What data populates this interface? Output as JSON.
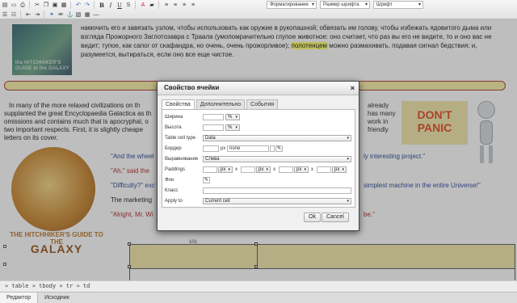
{
  "toolbar": {
    "format_select": "Форматирование",
    "font_size_select": "Размер шрифта",
    "font_select": "Шрифт"
  },
  "editor": {
    "book_cover_text": "the HITCHHIKER'S GUIDE to the GALAXY",
    "russian_text_before": "намочить его и завязать узлом, чтобы использовать как оружие в рукопашной; обвязать им голову, чтобы избежать ядовитого дыма или взгляда Прожорного Заглотозавра с Траала (умопомрачительно глупое животное: оно считает, что раз вы его не видите, то и оно вас не видит; тупое, как сапог от скафандра, но очень, очень прожорливое); ",
    "russian_text_highlight": "полотенцем",
    "russian_text_after": " можно размахивать, подавая сигнал бедствия; и, разумеется, вытираться, если оно все еще чистое.",
    "english_line1": "In many of the more relaxed civilizations on th",
    "english_line1_end": "already",
    "english_line2": "supplanted the great Encyclopaedia Galactica as th",
    "english_line2_end": "has many",
    "english_line3": "omissions and contains much that is apocryphal, o",
    "english_line3_end": "work in",
    "english_line4": "two important respects. First, it is slightly cheape",
    "english_line4_end": "friendly",
    "english_line5": "letters on its cover.",
    "dont_panic_line1": "DON'T",
    "dont_panic_line2": "PANIC",
    "logo_small": "THE HITCHHIKER'S GUIDE TO THE",
    "logo_big": "GALAXY",
    "quote1_start": "\"And the wheel",
    "quote1_end": "ly interesting project.\"",
    "quote2": "\"Ah,\" said the",
    "quote3_start": "\"Difficulty?\" exc",
    "quote3_end": "simplest machine in the entire Universe!\"",
    "quote4": "The marketing",
    "quote5_start": "\"Alright, Mr. Wi",
    "quote5_end": "be.\"",
    "table_size_label": "101"
  },
  "statusbar": {
    "path": "» table » tbody » tr » td"
  },
  "bottom_tabs": [
    {
      "label": "Редактор"
    },
    {
      "label": "Исходник"
    }
  ],
  "dialog": {
    "title": "Свойство ячейки",
    "close": "×",
    "tabs": [
      {
        "label": "Свойства"
      },
      {
        "label": "Дополнительно"
      },
      {
        "label": "События"
      }
    ],
    "fields": {
      "width_label": "Ширина",
      "width_unit": "%",
      "height_label": "Высота",
      "height_unit": "%",
      "cell_type_label": "Table cell type",
      "cell_type_value": "Data",
      "border_label": "Бордер",
      "border_unit": "px",
      "border_style": "none",
      "align_label": "Выравнивание",
      "align_value": "Слева",
      "padding_label": "Paddings",
      "padding_unit": "px",
      "padding_sep": "x",
      "bg_label": "Фон",
      "class_label": "Класс",
      "apply_label": "Apply to",
      "apply_value": "Current cell"
    },
    "ok": "Ok",
    "cancel": "Cancel"
  }
}
